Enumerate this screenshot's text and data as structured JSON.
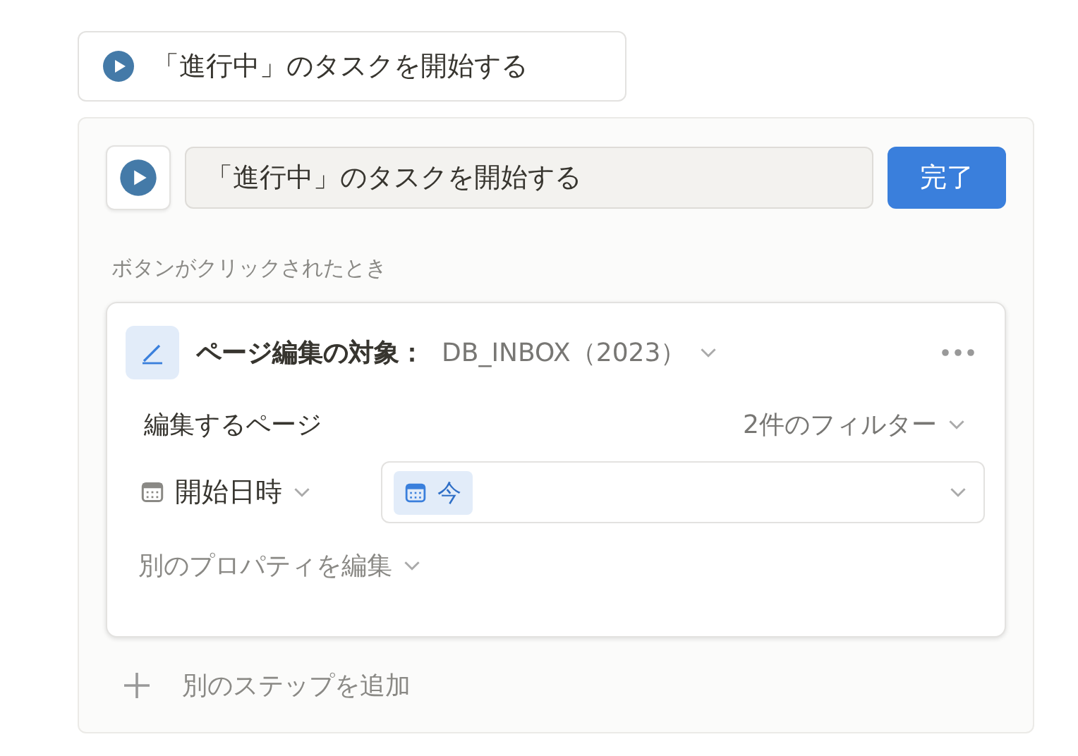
{
  "preview_button": {
    "label": "「進行中」のタスクを開始する"
  },
  "editor": {
    "name_field": {
      "value": "「進行中」のタスクを開始する"
    },
    "done_button": "完了",
    "trigger_label": "ボタンがクリックされたとき",
    "step": {
      "title": "ページ編集の対象：",
      "database": "DB_INBOX（2023）",
      "pages_label": "編集するページ",
      "filter": "2件のフィルター",
      "properties": [
        {
          "name": "開始日時",
          "value": "今"
        }
      ],
      "edit_other": "別のプロパティを編集"
    },
    "add_step": "別のステップを追加"
  }
}
